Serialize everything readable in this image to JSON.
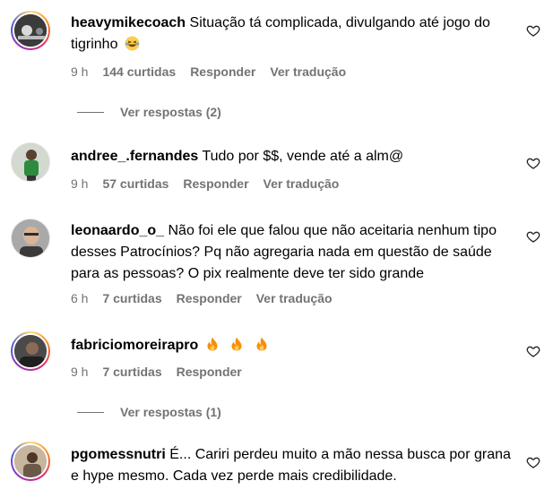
{
  "comments": [
    {
      "username": "heavymikecoach",
      "text": "Situação tá complicada, divulgando até jogo do tigrinho",
      "emoji_icon": "laughing-face-icon",
      "time": "9 h",
      "likes": "144 curtidas",
      "reply": "Responder",
      "translate": "Ver tradução",
      "replies": "Ver respostas (2)",
      "avatar_ring": true
    },
    {
      "username": "andree_.fernandes",
      "text": "Tudo por $$, vende até a alm@",
      "time": "9 h",
      "likes": "57 curtidas",
      "reply": "Responder",
      "translate": "Ver tradução",
      "avatar_ring": false
    },
    {
      "username": "leonaardo_o_",
      "text": "Não foi ele que falou que não aceitaria nenhum tipo desses Patrocínios? Pq não agregaria nada em questão de saúde para as pessoas? O pix realmente deve ter sido grande",
      "time": "6 h",
      "likes": "7 curtidas",
      "reply": "Responder",
      "translate": "Ver tradução",
      "avatar_ring": false
    },
    {
      "username": "fabriciomoreirapro",
      "text": "",
      "emoji_icon": "fire-icon",
      "emoji_count": 3,
      "time": "9 h",
      "likes": "7 curtidas",
      "reply": "Responder",
      "replies": "Ver respostas (1)",
      "avatar_ring": true
    },
    {
      "username": "pgomessnutri",
      "text": "É... Cariri perdeu muito a mão nessa busca por grana e hype mesmo. Cada vez perde mais credibilidade.",
      "avatar_ring": true
    }
  ],
  "colors": {
    "text": "#000000",
    "meta": "#737373",
    "fire": "#f4900c",
    "ring_start": "#feda75",
    "ring_end": "#962fbf"
  }
}
